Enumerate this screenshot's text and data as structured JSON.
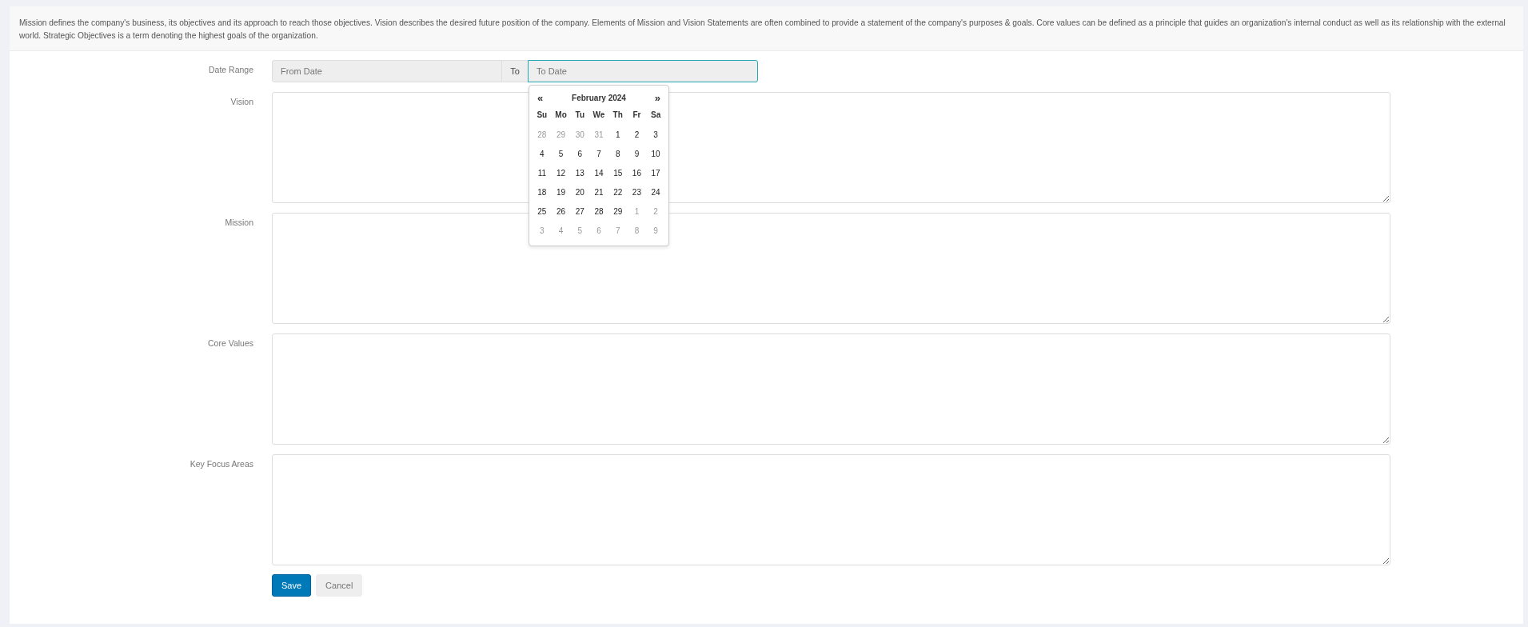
{
  "intro": "Mission defines the company's business, its objectives and its approach to reach those objectives. Vision describes the desired future position of the company. Elements of Mission and Vision Statements are often combined to provide a statement of the company's purposes & goals. Core values can be defined as a principle that guides an organization's internal conduct as well as its relationship with the external world. Strategic Objectives is a term denoting the highest goals of the organization.",
  "date_range": {
    "label": "Date Range",
    "from": {
      "placeholder": "From Date",
      "disabled": true
    },
    "separator": "To",
    "to": {
      "placeholder": "To Date",
      "focused": true
    }
  },
  "calendar": {
    "prev": "«",
    "title": "February 2024",
    "next": "»",
    "weekdays": [
      "Su",
      "Mo",
      "Tu",
      "We",
      "Th",
      "Fr",
      "Sa"
    ],
    "weeks": [
      [
        {
          "day": "28",
          "muted": true
        },
        {
          "day": "29",
          "muted": true
        },
        {
          "day": "30",
          "muted": true
        },
        {
          "day": "31",
          "muted": true
        },
        {
          "day": "1",
          "muted": false
        },
        {
          "day": "2",
          "muted": false
        },
        {
          "day": "3",
          "muted": false
        }
      ],
      [
        {
          "day": "4",
          "muted": false
        },
        {
          "day": "5",
          "muted": false
        },
        {
          "day": "6",
          "muted": false
        },
        {
          "day": "7",
          "muted": false
        },
        {
          "day": "8",
          "muted": false
        },
        {
          "day": "9",
          "muted": false
        },
        {
          "day": "10",
          "muted": false
        }
      ],
      [
        {
          "day": "11",
          "muted": false
        },
        {
          "day": "12",
          "muted": false
        },
        {
          "day": "13",
          "muted": false
        },
        {
          "day": "14",
          "muted": false
        },
        {
          "day": "15",
          "muted": false
        },
        {
          "day": "16",
          "muted": false
        },
        {
          "day": "17",
          "muted": false
        }
      ],
      [
        {
          "day": "18",
          "muted": false
        },
        {
          "day": "19",
          "muted": false
        },
        {
          "day": "20",
          "muted": false
        },
        {
          "day": "21",
          "muted": false
        },
        {
          "day": "22",
          "muted": false
        },
        {
          "day": "23",
          "muted": false
        },
        {
          "day": "24",
          "muted": false
        }
      ],
      [
        {
          "day": "25",
          "muted": false
        },
        {
          "day": "26",
          "muted": false
        },
        {
          "day": "27",
          "muted": false
        },
        {
          "day": "28",
          "muted": false
        },
        {
          "day": "29",
          "muted": false
        },
        {
          "day": "1",
          "muted": true
        },
        {
          "day": "2",
          "muted": true
        }
      ],
      [
        {
          "day": "3",
          "muted": true
        },
        {
          "day": "4",
          "muted": true
        },
        {
          "day": "5",
          "muted": true
        },
        {
          "day": "6",
          "muted": true
        },
        {
          "day": "7",
          "muted": true
        },
        {
          "day": "8",
          "muted": true
        },
        {
          "day": "9",
          "muted": true
        }
      ]
    ]
  },
  "fields": [
    {
      "label": "Vision"
    },
    {
      "label": "Mission"
    },
    {
      "label": "Core Values"
    },
    {
      "label": "Key Focus Areas"
    }
  ],
  "buttons": [
    {
      "label": "Save",
      "kind": "primary"
    },
    {
      "label": "Cancel",
      "kind": "secondary"
    }
  ]
}
